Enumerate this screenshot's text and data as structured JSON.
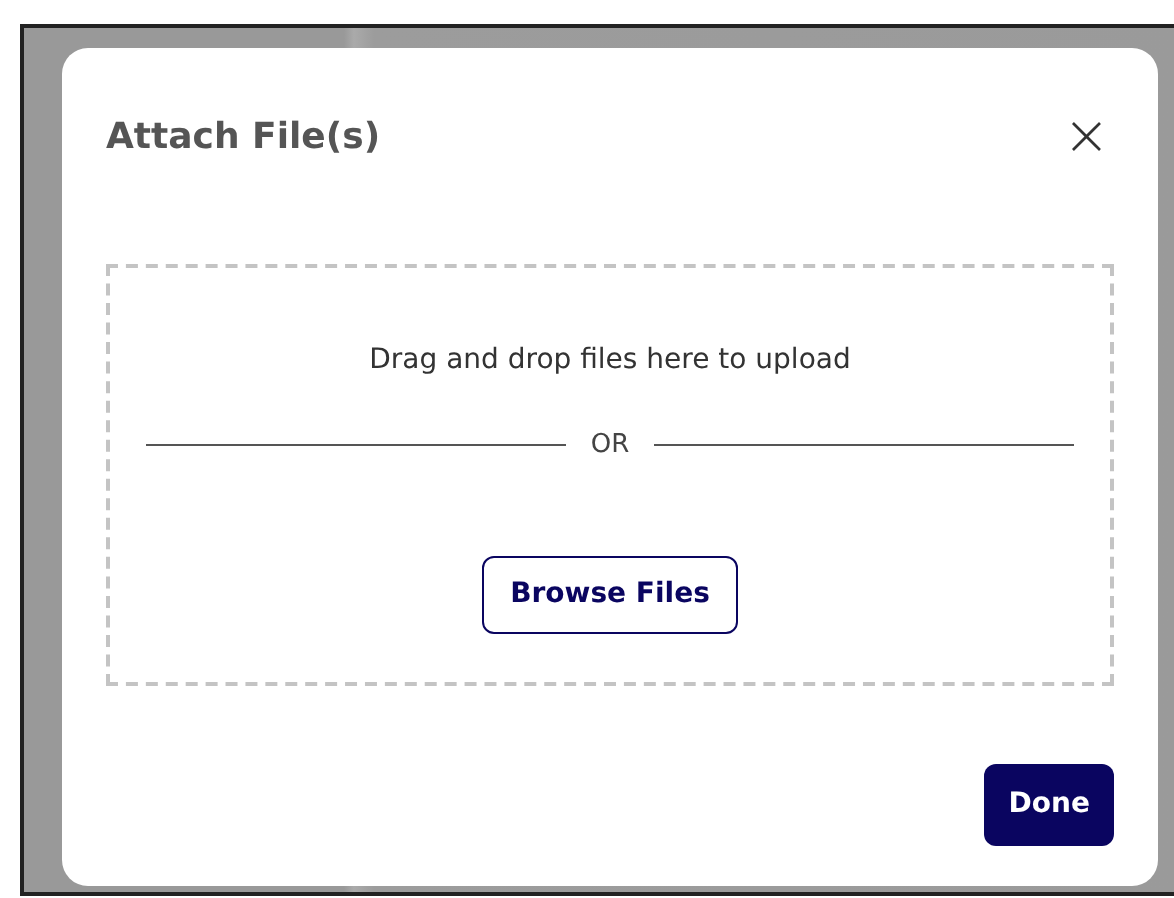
{
  "dialog": {
    "title": "Attach File(s)",
    "close": "×"
  },
  "dropzone": {
    "prompt": "Drag and drop files here to upload",
    "separator": "OR",
    "browse_button": "Browse Files"
  },
  "buttons": [
    "Done"
  ]
}
